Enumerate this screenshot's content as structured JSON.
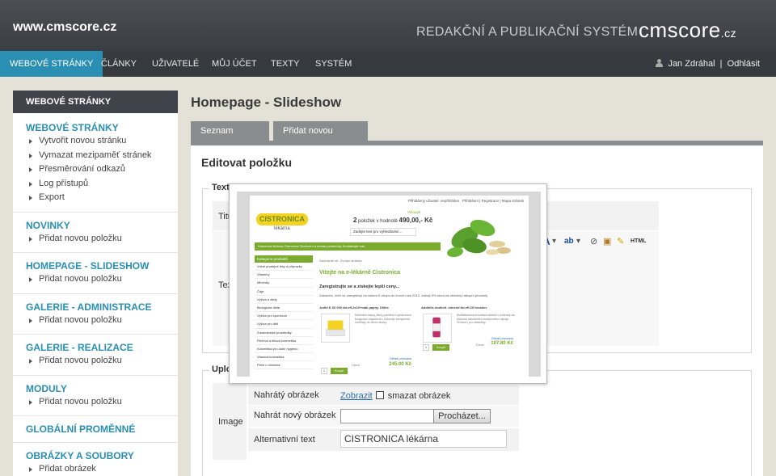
{
  "header": {
    "site_url": "www.cmscore.cz",
    "tagline": "REDAKČNÍ A PUBLIKAČNÍ SYSTÉM",
    "logo_main": "cmscore",
    "logo_tld": ".cz"
  },
  "nav": {
    "items": [
      "WEBOVÉ STRÁNKY",
      "ČLÁNKY",
      "UŽIVATELÉ",
      "MŮJ ÚČET",
      "TEXTY",
      "SYSTÉM"
    ],
    "active_index": 0,
    "user": "Jan Zdráhal",
    "separator": "|",
    "logout": "Odhlásit"
  },
  "sidebar": {
    "title": "WEBOVÉ STRÁNKY",
    "sections": [
      {
        "title": "WEBOVÉ STRÁNKY",
        "items": [
          "Vytvořit novou stránku",
          "Vymazat mezipaměť stránek",
          "Přesměrování odkazů",
          "Log přístupů",
          "Export"
        ]
      },
      {
        "title": "NOVINKY",
        "items": [
          "Přidat novou položku"
        ]
      },
      {
        "title": "HOMEPAGE - SLIDESHOW",
        "items": [
          "Přidat novou položku"
        ]
      },
      {
        "title": "GALERIE - ADMINISTRACE",
        "items": [
          "Přidat novou položku"
        ]
      },
      {
        "title": "GALERIE - REALIZACE",
        "items": [
          "Přidat novou položku"
        ]
      },
      {
        "title": "MODULY",
        "items": [
          "Přidat novou položku"
        ]
      },
      {
        "title": "GLOBÁLNÍ PROMĚNNÉ",
        "items": []
      },
      {
        "title": "OBRÁZKY A SOUBORY",
        "items": [
          "Přidat obrázek"
        ]
      }
    ]
  },
  "main": {
    "page_title": "Homepage - Slideshow",
    "tabs": [
      "Seznam položek",
      "Přidat novou položku"
    ],
    "edit_title": "Editovat položku",
    "fieldset_text_legend": "Text",
    "title_label": "Titu",
    "text_label": "Tex",
    "fieldset_upload_legend": "Uplo",
    "image_label": "Image",
    "uploaded_image_label": "Nahrátý obrázek",
    "show_link": "Zobrazit",
    "delete_image_label": "smazat obrázek",
    "upload_new_label": "Nahrát nový obrázek",
    "browse_button": "Procházet...",
    "alt_text_label": "Alternativní text",
    "alt_text_value": "CISTRONICA lékárna",
    "editor_html_button": "HTML"
  },
  "preview": {
    "top_links": "Přihlášení | Registrace | Mapa stránek",
    "top_prefix": "Přihlášený uživatel: nepřihlášen",
    "logo": "CISTRONICA",
    "logo_sub": "lékárna",
    "cart_count": "2",
    "cart_text": "položek v hodnotě",
    "cart_price": "490,00,- Kč",
    "cart_view": "Vstoupit",
    "search_placeholder": "Zadejte text pro vyhledávání...",
    "menu": "Kamenná lékárna Cistronica    Obchodní a dodací podmínky    Kontaktujte nás",
    "categories_title": "Kategorie produktů",
    "categories": [
      "Volně prodejné léky a přípravky",
      "Vitamíny",
      "Minerály",
      "Čaje",
      "Výživa a diety",
      "Biologická dieta",
      "Výživa pro sportovce",
      "Výživa pro děti",
      "Zdravotnické prostředky",
      "Pleťová a tělová kosmetika",
      "Kosmetika pro ústní hygienu",
      "Vlasová kosmetika",
      "Péče o miminka"
    ],
    "breadcrumb": "Nacházíte se: Úvodní stránka",
    "welcome": "Vítejte na e-lékárně Cistronica",
    "headline": "Zaregistrujte se a získejte lepší ceny...",
    "paragraph": "Zákazníci, kteří se zaregistrují na našem E-shopu do konce roku 2012, získají 5% slevu na všechny nákupní produkty.",
    "product1_name": "Jodid K 60 000 tbl.eff.2x10+mák papíry 100ks",
    "product1_price": "245.00 Kč",
    "product1_desc": "Minerální nápoj, který pomáhá k správnému fungování organizmu. Zahrnuje komplexně minerály do denní stravy.",
    "product2_name": "Addisfix multivit. minerál tbl.eff.20 broskev",
    "product2_price": "107.80 Kč",
    "product2_desc": "Multivitamínová šumivá tableta s minerály na přípravu lahodného broskvového nápoje. Vhodná i pro diabetiky.",
    "buy_button": "Koupit",
    "price_label": "Cena",
    "detail_link": "Detail produktu",
    "qty": "1"
  }
}
